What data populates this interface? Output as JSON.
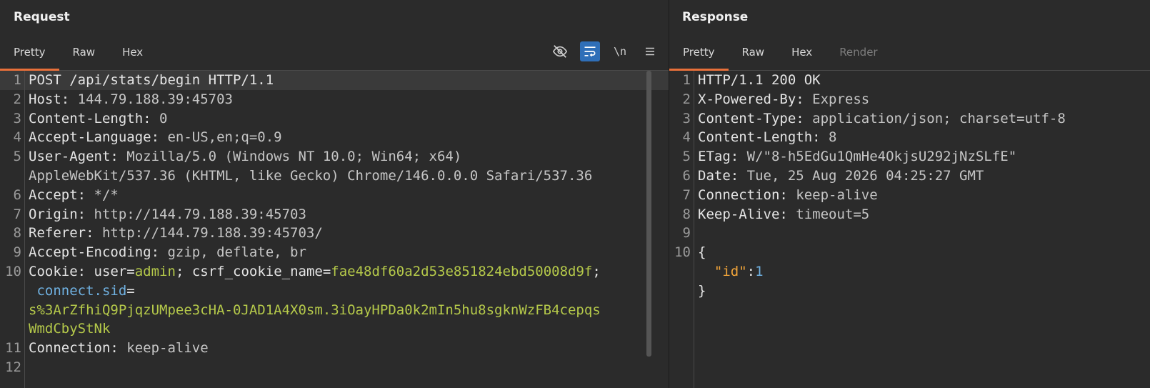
{
  "request": {
    "title": "Request",
    "tabs": [
      "Pretty",
      "Raw",
      "Hex"
    ],
    "toolbar": {
      "hide_icon": "eye-slash-icon",
      "wrap_icon": "wrap-lines-icon",
      "newline_label": "\\n",
      "menu_icon": "hamburger-menu-icon"
    },
    "lines": [
      {
        "n": "1",
        "parts": [
          {
            "t": "POST /api/stats/begin HTTP/1.1",
            "c": "k"
          }
        ]
      },
      {
        "n": "2",
        "parts": [
          {
            "t": "Host: ",
            "c": "k"
          },
          {
            "t": "144.79.188.39:45703",
            "c": "v"
          }
        ]
      },
      {
        "n": "3",
        "parts": [
          {
            "t": "Content-Length: ",
            "c": "k"
          },
          {
            "t": "0",
            "c": "v"
          }
        ]
      },
      {
        "n": "4",
        "parts": [
          {
            "t": "Accept-Language: ",
            "c": "k"
          },
          {
            "t": "en-US,en;q=0.9",
            "c": "v"
          }
        ]
      },
      {
        "n": "5",
        "parts": [
          {
            "t": "User-Agent: ",
            "c": "k"
          },
          {
            "t": "Mozilla/5.0 (Windows NT 10.0; Win64; x64)",
            "c": "v"
          }
        ]
      },
      {
        "n": "",
        "parts": [
          {
            "t": "AppleWebKit/537.36 (KHTML, like Gecko) Chrome/146.0.0.0 Safari/537.36",
            "c": "v"
          }
        ]
      },
      {
        "n": "6",
        "parts": [
          {
            "t": "Accept: ",
            "c": "k"
          },
          {
            "t": "*/*",
            "c": "v"
          }
        ]
      },
      {
        "n": "7",
        "parts": [
          {
            "t": "Origin: ",
            "c": "k"
          },
          {
            "t": "http://144.79.188.39:45703",
            "c": "v"
          }
        ]
      },
      {
        "n": "8",
        "parts": [
          {
            "t": "Referer: ",
            "c": "k"
          },
          {
            "t": "http://144.79.188.39:45703/",
            "c": "v"
          }
        ]
      },
      {
        "n": "9",
        "parts": [
          {
            "t": "Accept-Encoding: ",
            "c": "k"
          },
          {
            "t": "gzip, deflate, br",
            "c": "v"
          }
        ]
      },
      {
        "n": "10",
        "parts": [
          {
            "t": "Cookie: ",
            "c": "k"
          },
          {
            "t": "user",
            "c": "k"
          },
          {
            "t": "=",
            "c": "k"
          },
          {
            "t": "admin",
            "c": "g"
          },
          {
            "t": "; csrf_cookie_name",
            "c": "k"
          },
          {
            "t": "=",
            "c": "k"
          },
          {
            "t": "fae48df60a2d53e851824ebd50008d9f",
            "c": "g"
          },
          {
            "t": ";",
            "c": "k"
          }
        ]
      },
      {
        "n": "",
        "parts": [
          {
            "t": " connect.sid",
            "c": "n"
          },
          {
            "t": "=",
            "c": "k"
          }
        ]
      },
      {
        "n": "",
        "parts": [
          {
            "t": "s%3ArZfhiQ9PjqzUMpee3cHA-0JAD1A4X0sm.3iOayHPDa0k2mIn5hu8sgknWzFB4cepqs",
            "c": "g"
          }
        ]
      },
      {
        "n": "",
        "parts": [
          {
            "t": "WmdCbyStNk",
            "c": "g"
          }
        ]
      },
      {
        "n": "11",
        "parts": [
          {
            "t": "Connection: ",
            "c": "k"
          },
          {
            "t": "keep-alive",
            "c": "v"
          }
        ]
      },
      {
        "n": "12",
        "parts": []
      }
    ]
  },
  "response": {
    "title": "Response",
    "tabs": [
      "Pretty",
      "Raw",
      "Hex",
      "Render"
    ],
    "lines": [
      {
        "n": "1",
        "parts": [
          {
            "t": "HTTP/1.1 200 OK",
            "c": "k"
          }
        ]
      },
      {
        "n": "2",
        "parts": [
          {
            "t": "X-Powered-By: ",
            "c": "k"
          },
          {
            "t": "Express",
            "c": "v"
          }
        ]
      },
      {
        "n": "3",
        "parts": [
          {
            "t": "Content-Type: ",
            "c": "k"
          },
          {
            "t": "application/json; charset=utf-8",
            "c": "v"
          }
        ]
      },
      {
        "n": "4",
        "parts": [
          {
            "t": "Content-Length: ",
            "c": "k"
          },
          {
            "t": "8",
            "c": "v"
          }
        ]
      },
      {
        "n": "5",
        "parts": [
          {
            "t": "ETag: ",
            "c": "k"
          },
          {
            "t": "W/\"8-h5EdGu1QmHe4OkjsU292jNzSLfE\"",
            "c": "v"
          }
        ]
      },
      {
        "n": "6",
        "parts": [
          {
            "t": "Date: ",
            "c": "k"
          },
          {
            "t": "Tue, 25 Aug 2026 04:25:27 GMT",
            "c": "v"
          }
        ]
      },
      {
        "n": "7",
        "parts": [
          {
            "t": "Connection: ",
            "c": "k"
          },
          {
            "t": "keep-alive",
            "c": "v"
          }
        ]
      },
      {
        "n": "8",
        "parts": [
          {
            "t": "Keep-Alive: ",
            "c": "k"
          },
          {
            "t": "timeout=5",
            "c": "v"
          }
        ]
      },
      {
        "n": "9",
        "parts": []
      },
      {
        "n": "10",
        "parts": [
          {
            "t": "{",
            "c": "k"
          }
        ]
      },
      {
        "n": "",
        "parts": [
          {
            "t": "  ",
            "c": "k"
          },
          {
            "t": "\"id\"",
            "c": "o"
          },
          {
            "t": ":",
            "c": "k"
          },
          {
            "t": "1",
            "c": "n"
          }
        ]
      },
      {
        "n": "",
        "parts": [
          {
            "t": "}",
            "c": "k"
          }
        ]
      }
    ]
  },
  "colors": {
    "accent": "#e8703a",
    "string": "#b5c94a",
    "key": "#f2a53a",
    "number": "#6fb0e0",
    "toggle_on": "#2f6fb8"
  }
}
